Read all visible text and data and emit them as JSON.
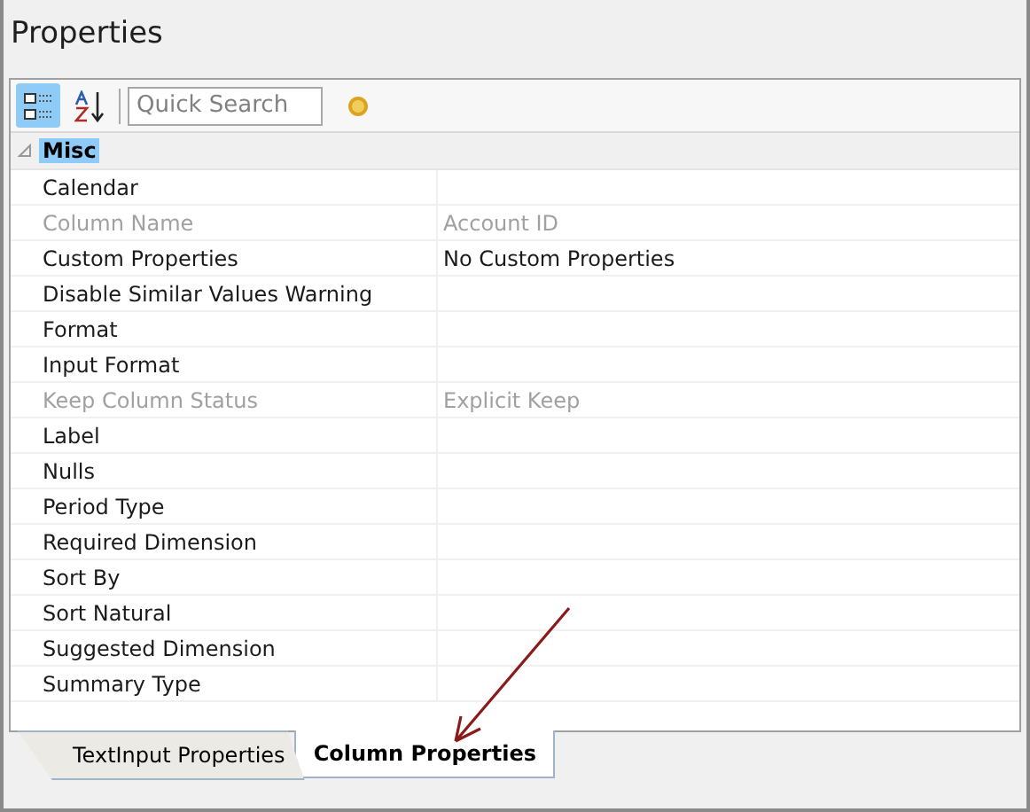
{
  "window": {
    "title": "Properties"
  },
  "toolbar": {
    "buttons": [
      {
        "kind": "categorized",
        "selected": true
      },
      {
        "kind": "alphabetical",
        "selected": false
      }
    ],
    "search": {
      "placeholder": "Quick Search"
    }
  },
  "grid": {
    "category": {
      "label": "Misc",
      "expanded": true,
      "selected": true
    },
    "rows": [
      {
        "name": "Calendar",
        "value": "",
        "disabled": false
      },
      {
        "name": "Column Name",
        "value": "Account ID",
        "disabled": true
      },
      {
        "name": "Custom Properties",
        "value": "No Custom Properties",
        "disabled": false
      },
      {
        "name": "Disable Similar Values Warning",
        "value": "",
        "disabled": false
      },
      {
        "name": "Format",
        "value": "",
        "disabled": false
      },
      {
        "name": "Input Format",
        "value": "",
        "disabled": false
      },
      {
        "name": "Keep Column Status",
        "value": "Explicit Keep",
        "disabled": true
      },
      {
        "name": "Label",
        "value": "",
        "disabled": false
      },
      {
        "name": "Nulls",
        "value": "",
        "disabled": false
      },
      {
        "name": "Period Type",
        "value": "",
        "disabled": false
      },
      {
        "name": "Required Dimension",
        "value": "",
        "disabled": false
      },
      {
        "name": "Sort By",
        "value": "",
        "disabled": false
      },
      {
        "name": "Sort Natural",
        "value": "",
        "disabled": false
      },
      {
        "name": "Suggested Dimension",
        "value": "",
        "disabled": false
      },
      {
        "name": "Summary Type",
        "value": "",
        "disabled": false
      }
    ]
  },
  "tabs": [
    {
      "label": "TextInput Properties",
      "selected": false
    },
    {
      "label": "Column Properties",
      "selected": true
    }
  ]
}
